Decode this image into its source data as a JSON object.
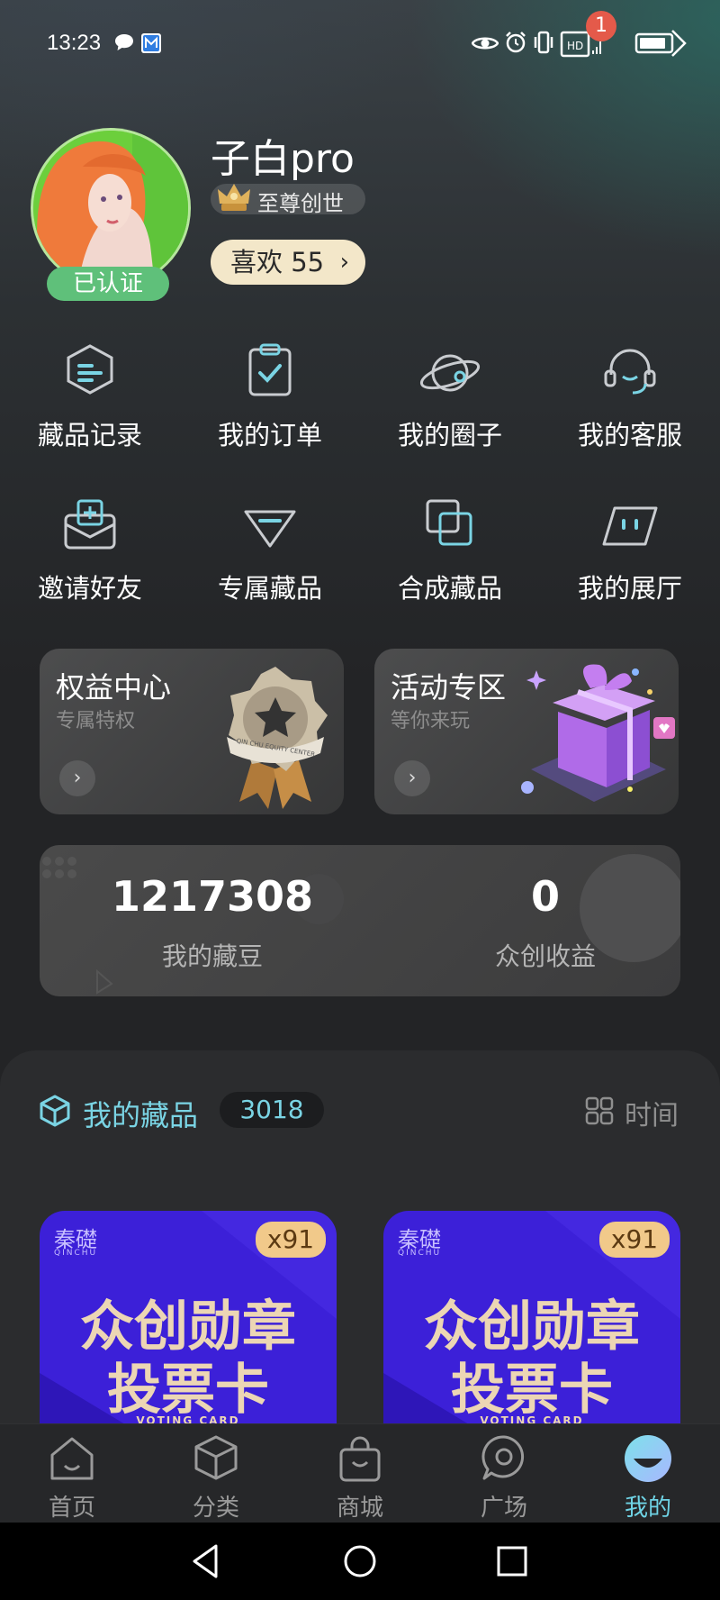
{
  "status_bar": {
    "time": "13:23",
    "notification_count": "1"
  },
  "profile": {
    "username": "子白pro",
    "rank": "至尊创世",
    "verified_label": "已认证",
    "likes_label": "喜欢 55",
    "likes_chevron": "›"
  },
  "menu": [
    {
      "label": "藏品记录",
      "icon": "collection-record-icon"
    },
    {
      "label": "我的订单",
      "icon": "order-clipboard-icon"
    },
    {
      "label": "我的圈子",
      "icon": "planet-icon"
    },
    {
      "label": "我的客服",
      "icon": "headset-icon"
    },
    {
      "label": "邀请好友",
      "icon": "invite-mail-icon"
    },
    {
      "label": "专属藏品",
      "icon": "diamond-icon"
    },
    {
      "label": "合成藏品",
      "icon": "merge-squares-icon"
    },
    {
      "label": "我的展厅",
      "icon": "robot-face-icon"
    }
  ],
  "promos": [
    {
      "title": "权益中心",
      "subtitle": "专属特权",
      "badge_text": "QIN CHU EQUITY CENTER"
    },
    {
      "title": "活动专区",
      "subtitle": "等你来玩"
    }
  ],
  "stats": {
    "beans_value": "1217308",
    "beans_label": "我的藏豆",
    "earnings_value": "0",
    "earnings_label": "众创收益"
  },
  "collection": {
    "title": "我的藏品",
    "count": "3018",
    "sort_label": "时间",
    "cards": [
      {
        "brand": "秦礎",
        "brand_sub": "QINCHU",
        "qty": "x91",
        "line1": "众创勋章",
        "line2": "投票卡",
        "footer": "VOTING CARD"
      },
      {
        "brand": "秦礎",
        "brand_sub": "QINCHU",
        "qty": "x91",
        "line1": "众创勋章",
        "line2": "投票卡",
        "footer": "VOTING CARD"
      }
    ]
  },
  "tabs": [
    {
      "label": "首页",
      "icon": "home-icon"
    },
    {
      "label": "分类",
      "icon": "cube-icon"
    },
    {
      "label": "商城",
      "icon": "shopping-bag-icon"
    },
    {
      "label": "广场",
      "icon": "chat-bubble-icon"
    },
    {
      "label": "我的",
      "icon": "profile-face-icon",
      "active": true
    }
  ],
  "colors": {
    "accent": "#6fd4e6",
    "verified": "#5fc07a",
    "likes_bg": "#f3e7c9",
    "card_bg": "#3c20d8",
    "card_text": "#ecd6b4",
    "qty_badge": "#f1c98a"
  }
}
